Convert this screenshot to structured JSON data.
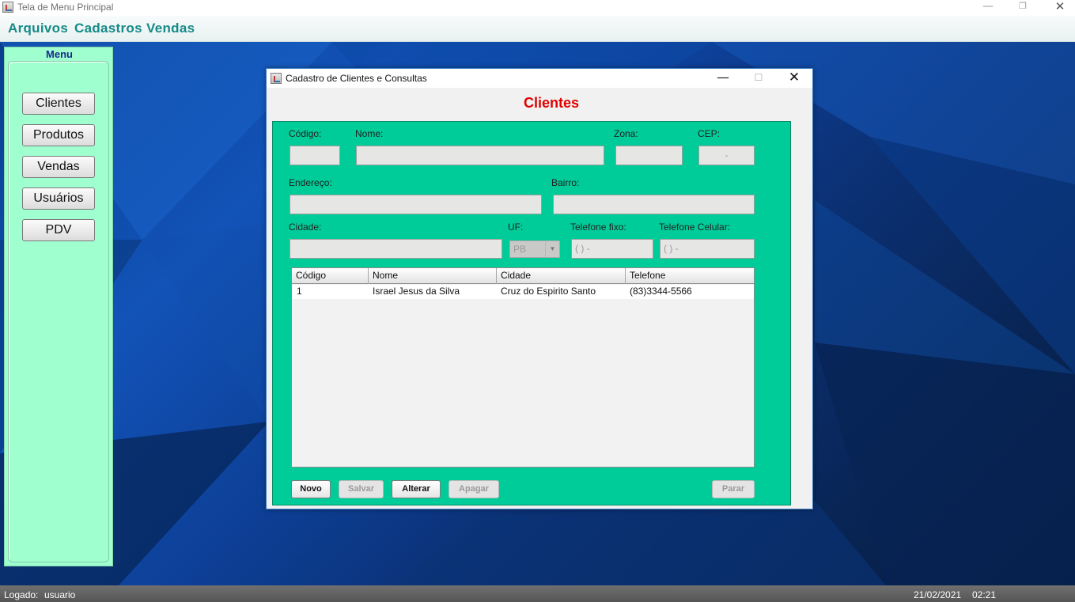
{
  "window": {
    "title": "Tela de Menu Principal",
    "min_glyph": "—",
    "max_glyph": "❐",
    "close_glyph": "✕"
  },
  "menubar": {
    "items": [
      "Arquivos",
      "Cadastros",
      "Vendas"
    ]
  },
  "side_menu": {
    "title": "Menu",
    "buttons": [
      "Clientes",
      "Produtos",
      "Vendas",
      "Usuários",
      "PDV"
    ]
  },
  "statusbar": {
    "logged_label": "Logado:",
    "user": "usuario",
    "date": "21/02/2021",
    "time": "02:21"
  },
  "internal_frame": {
    "title": "Cadastro de Clientes e Consultas",
    "min_glyph": "—",
    "max_glyph": "☐",
    "close_glyph": "✕",
    "heading": "Clientes",
    "labels": {
      "codigo": "Código:",
      "nome": "Nome:",
      "zona": "Zona:",
      "cep": "CEP:",
      "endereco": "Endereço:",
      "bairro": "Bairro:",
      "cidade": "Cidade:",
      "uf": "UF:",
      "tel_fixo": "Telefone fixo:",
      "tel_celular": "Telefone Celular:"
    },
    "fields": {
      "codigo": "",
      "nome": "",
      "zona": "",
      "cep": "-",
      "endereco": "",
      "bairro": "",
      "cidade": "",
      "uf": "PB",
      "tel_fixo": "(  )    -",
      "tel_celular": "(  )    -"
    },
    "table": {
      "columns": [
        "Código",
        "Nome",
        "Cidade",
        "Telefone"
      ],
      "rows": [
        [
          "1",
          "Israel Jesus da Silva",
          "Cruz do Espirito Santo",
          "(83)3344-5566"
        ]
      ]
    },
    "buttons": {
      "novo": "Novo",
      "salvar": "Salvar",
      "alterar": "Alterar",
      "apagar": "Apagar",
      "parar": "Parar"
    }
  }
}
